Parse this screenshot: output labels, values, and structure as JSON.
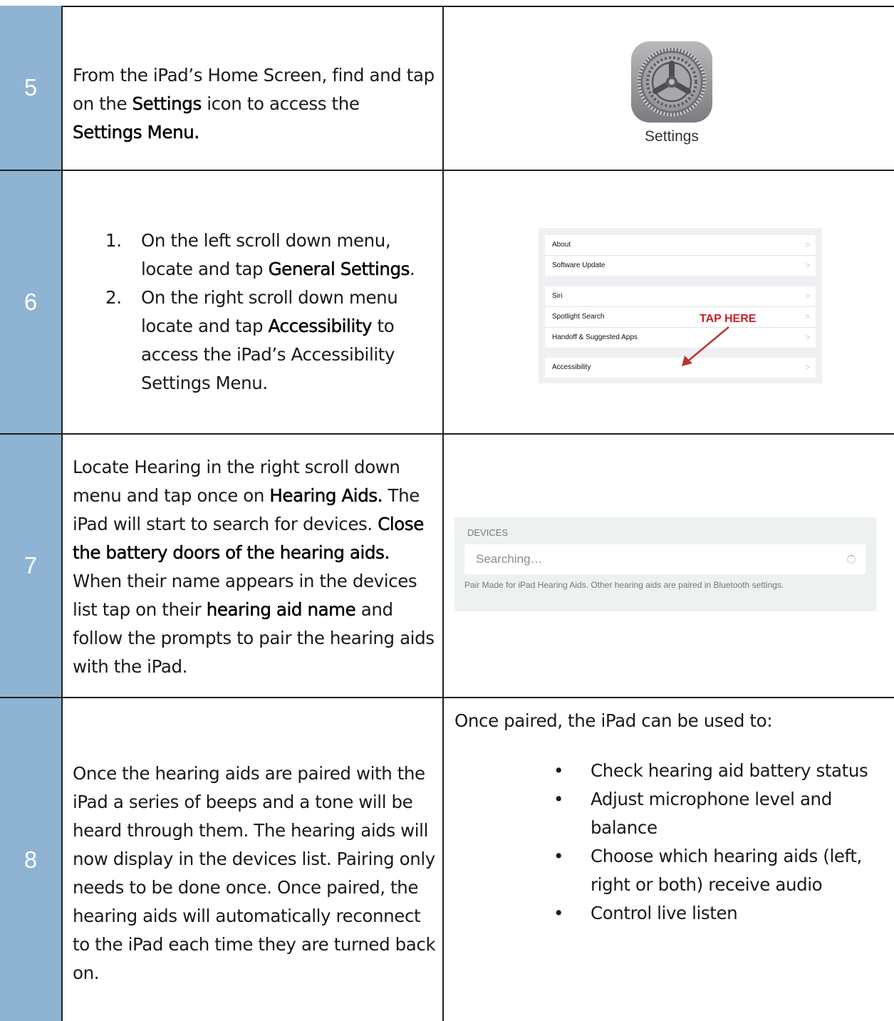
{
  "rows": [
    {
      "number": "5",
      "text_segments": [
        "From the iPad’s Home Screen, find and tap on the ",
        "Settings",
        " icon to access the ",
        "Settings Menu."
      ],
      "image": {
        "icon_name": "settings-gear-icon",
        "label": "Settings"
      }
    },
    {
      "number": "6",
      "steps": [
        {
          "num": "1.",
          "segments": [
            "On the left scroll down menu, locate and tap ",
            "General Settings",
            "."
          ]
        },
        {
          "num": "2.",
          "segments": [
            "On the right scroll down menu locate and tap ",
            "Accessibility",
            " to access the iPad’s Accessibility Settings Menu."
          ]
        }
      ],
      "image": {
        "groups": [
          [
            "About",
            "Software Update"
          ],
          [
            "Siri",
            "Spotlight Search",
            "Handoff & Suggested Apps"
          ],
          [
            "Accessibility"
          ]
        ],
        "chevron": ">",
        "callout": "TAP HERE"
      }
    },
    {
      "number": "7",
      "text_segments": [
        "Locate Hearing in the right scroll down menu and tap once on ",
        "Hearing Aids.",
        " The iPad will start to search for devices. ",
        "Close the battery doors of the hearing aids.",
        " When their name appears in the devices list tap on their ",
        "hearing aid name",
        " and follow the prompts to pair the hearing aids with the iPad."
      ],
      "image": {
        "header": "DEVICES",
        "status": "Searching…",
        "note": "Pair Made for iPad Hearing Aids. Other hearing aids are paired in Bluetooth settings."
      }
    },
    {
      "number": "8",
      "text": "Once the hearing aids are paired with the iPad a series of beeps and a tone will be heard through them. The hearing aids will now display in the devices list. Pairing only needs to be done once. Once paired, the hearing aids will automatically reconnect to the iPad each time they are turned back on.",
      "intro": "Once paired, the iPad can be used to:",
      "bullet_glyph": "•",
      "bullets": [
        "Check hearing aid battery status",
        "Adjust microphone level and balance",
        "Choose which hearing aids (left, right or both) receive audio",
        "Control live listen"
      ]
    }
  ],
  "colors": {
    "number_cell": "#8eb3d3",
    "border": "#1f1f1f",
    "callout": "#c8202a"
  }
}
